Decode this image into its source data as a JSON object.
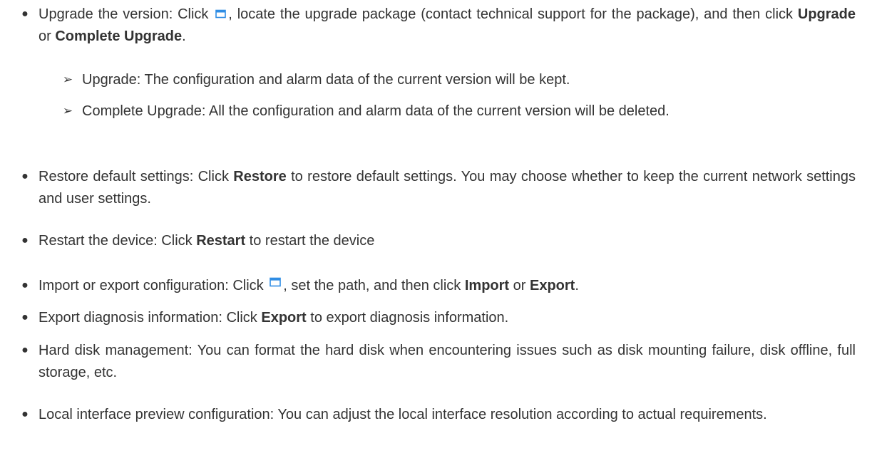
{
  "bullet_glyph": "●",
  "sub_bullet_glyph": "➢",
  "icons": {
    "browse": "folder-window-icon",
    "color": "#2f8de4"
  },
  "items": [
    {
      "lead": "Upgrade the version: Click ",
      "after_icon": ", locate the upgrade package (contact technical support for the package), and then click ",
      "b1": "Upgrade",
      "mid": " or ",
      "b2": "Complete Upgrade",
      "end": "."
    },
    {
      "text": "Upgrade: The configuration and alarm data of the current version will be kept."
    },
    {
      "text": "Complete Upgrade: All the configuration and alarm data of the current version will be deleted."
    },
    {
      "lead": "Restore default settings: Click ",
      "b1": "Restore",
      "rest": " to restore default settings. You may choose whether to keep the current network settings and user settings."
    },
    {
      "lead": "Restart the device: Click ",
      "b1": "Restart",
      "rest": " to restart the device"
    },
    {
      "lead": "Import or export configuration: Click ",
      "after_icon": ", set the path, and then click ",
      "b1": "Import",
      "mid": " or ",
      "b2": "Export",
      "end": "."
    },
    {
      "lead": "Export diagnosis information: Click ",
      "b1": "Export",
      "rest": " to export diagnosis information."
    },
    {
      "text": "Hard disk management: You can format the hard disk when encountering issues such as disk mounting failure, disk offline, full storage, etc."
    },
    {
      "text": "Local interface preview configuration: You can adjust the local interface resolution according to actual requirements."
    }
  ]
}
